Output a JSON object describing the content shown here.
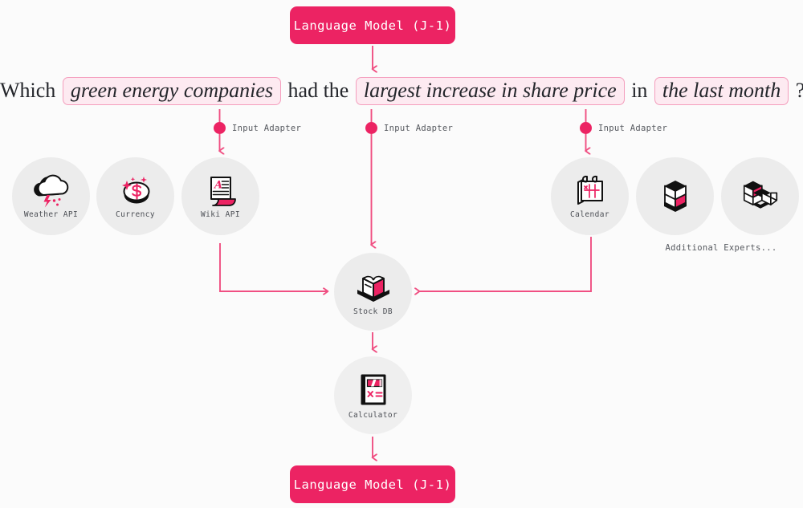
{
  "colors": {
    "accent": "#ec2363",
    "accent_line": "#f04f82",
    "chip_fill": "#fdeaf1",
    "chip_border": "#f49ebd",
    "circle_bg": "#ececec",
    "background": "#fbfbfb",
    "text_dark": "#24262b",
    "text_muted": "#55585e"
  },
  "top_model": {
    "label": "Language Model (J-1)"
  },
  "bottom_model": {
    "label": "Language Model (J-1)"
  },
  "query": {
    "segments": [
      {
        "type": "plain",
        "text": "Which"
      },
      {
        "type": "chip",
        "text": "green energy companies"
      },
      {
        "type": "plain",
        "text": "had the"
      },
      {
        "type": "chip",
        "text": "largest increase in share price"
      },
      {
        "type": "plain",
        "text": "in"
      },
      {
        "type": "chip",
        "text": "the last month"
      },
      {
        "type": "plain",
        "text": "?"
      }
    ]
  },
  "adapters": [
    {
      "label": "Input Adapter",
      "icon": "dot-marker-icon"
    },
    {
      "label": "Input Adapter",
      "icon": "dot-marker-icon"
    },
    {
      "label": "Input Adapter",
      "icon": "dot-marker-icon"
    }
  ],
  "experts": {
    "weather": {
      "label": "Weather API",
      "icon": "cloud-lightning-icon"
    },
    "currency": {
      "label": "Currency",
      "icon": "dollar-coin-icon"
    },
    "wiki": {
      "label": "Wiki API",
      "icon": "document-page-icon"
    },
    "calendar": {
      "label": "Calendar",
      "icon": "calendar-icon"
    },
    "extra1": {
      "label": "",
      "icon": "stacked-cubes-icon"
    },
    "extra2": {
      "label": "",
      "icon": "cube-cluster-icon"
    },
    "stock": {
      "label": "Stock DB",
      "icon": "open-box-icon"
    },
    "calculator": {
      "label": "Calculator",
      "icon": "calculator-icon"
    }
  },
  "additional_experts": {
    "label": "Additional Experts..."
  }
}
